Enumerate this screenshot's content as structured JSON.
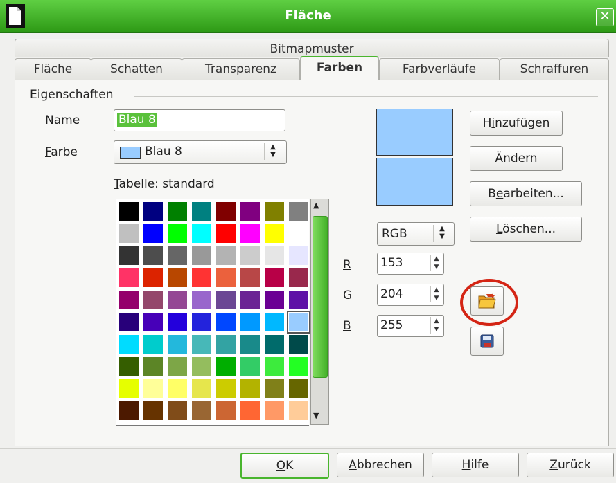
{
  "window": {
    "title": "Fläche"
  },
  "tabs_row1": [
    {
      "label": "Bitmapmuster"
    }
  ],
  "tabs_row2": [
    {
      "label": "Fläche"
    },
    {
      "label": "Schatten"
    },
    {
      "label": "Transparenz"
    },
    {
      "label": "Farben",
      "active": true
    },
    {
      "label": "Farbverläufe"
    },
    {
      "label": "Schraffuren"
    }
  ],
  "section": {
    "title": "Eigenschaften"
  },
  "name_field": {
    "label_underline": "N",
    "label_rest": "ame",
    "value": "Blau 8"
  },
  "color_field": {
    "label_underline": "F",
    "label_rest": "arbe",
    "value": "Blau 8",
    "swatch": "#99ccff"
  },
  "table": {
    "label_underline": "T",
    "label_rest": "abelle: standard"
  },
  "color_model": {
    "value": "RGB"
  },
  "rgb": {
    "r_label": "R",
    "r_value": "153",
    "g_label": "G",
    "g_value": "204",
    "b_label": "B",
    "b_value": "255"
  },
  "buttons": {
    "add": {
      "pre": "H",
      "u": "i",
      "post": "nzufügen"
    },
    "modify": {
      "pre": "",
      "u": "Ä",
      "post": "ndern"
    },
    "edit": {
      "pre": "B",
      "u": "e",
      "post": "arbeiten..."
    },
    "delete": {
      "pre": "",
      "u": "L",
      "post": "öschen..."
    }
  },
  "icons": {
    "load": "open-folder-icon",
    "save": "floppy-disk-icon"
  },
  "footer": {
    "ok": {
      "u": "O",
      "post": "K"
    },
    "cancel": {
      "u": "A",
      "post": "bbrechen"
    },
    "help": {
      "u": "H",
      "post": "ilfe"
    },
    "reset": {
      "u": "Z",
      "post": "urück"
    }
  },
  "palette": [
    [
      "#000000",
      "#000080",
      "#008000",
      "#008080",
      "#800000",
      "#800080",
      "#808000",
      "#808080"
    ],
    [
      "#c0c0c0",
      "#0000ff",
      "#00ff00",
      "#00ffff",
      "#ff0000",
      "#ff00ff",
      "#ffff00",
      "#ffffff"
    ],
    [
      "#333333",
      "#4d4d4d",
      "#666666",
      "#999999",
      "#b3b3b3",
      "#cccccc",
      "#e6e6e6",
      "#e6e6ff"
    ],
    [
      "#ff3366",
      "#dc2300",
      "#b84700",
      "#ff3333",
      "#eb613d",
      "#b84747",
      "#b80047",
      "#99284c"
    ],
    [
      "#94006b",
      "#94476b",
      "#944794",
      "#9966cc",
      "#6b4794",
      "#6b2394",
      "#6b0094",
      "#5e11a6"
    ],
    [
      "#28007a",
      "#4700b8",
      "#2300dc",
      "#2323dc",
      "#0047ff",
      "#0099ff",
      "#00b8ff",
      "#99ccff"
    ],
    [
      "#00dcff",
      "#00cccc",
      "#23b8dc",
      "#47b8b8",
      "#33a3a3",
      "#198a8a",
      "#006b6b",
      "#004a4a"
    ],
    [
      "#355e00",
      "#5c8526",
      "#7da647",
      "#94bd5e",
      "#00ae00",
      "#33cc66",
      "#3deb3d",
      "#23ff23"
    ],
    [
      "#e6ff00",
      "#ffff99",
      "#ffff66",
      "#e6e64c",
      "#cccc00",
      "#b3b300",
      "#808019",
      "#666600"
    ],
    [
      "#4c1900",
      "#663300",
      "#804c19",
      "#996633",
      "#cc6633",
      "#ff6633",
      "#ff9966",
      "#ffcc99"
    ]
  ],
  "selected_cell": [
    5,
    7
  ]
}
